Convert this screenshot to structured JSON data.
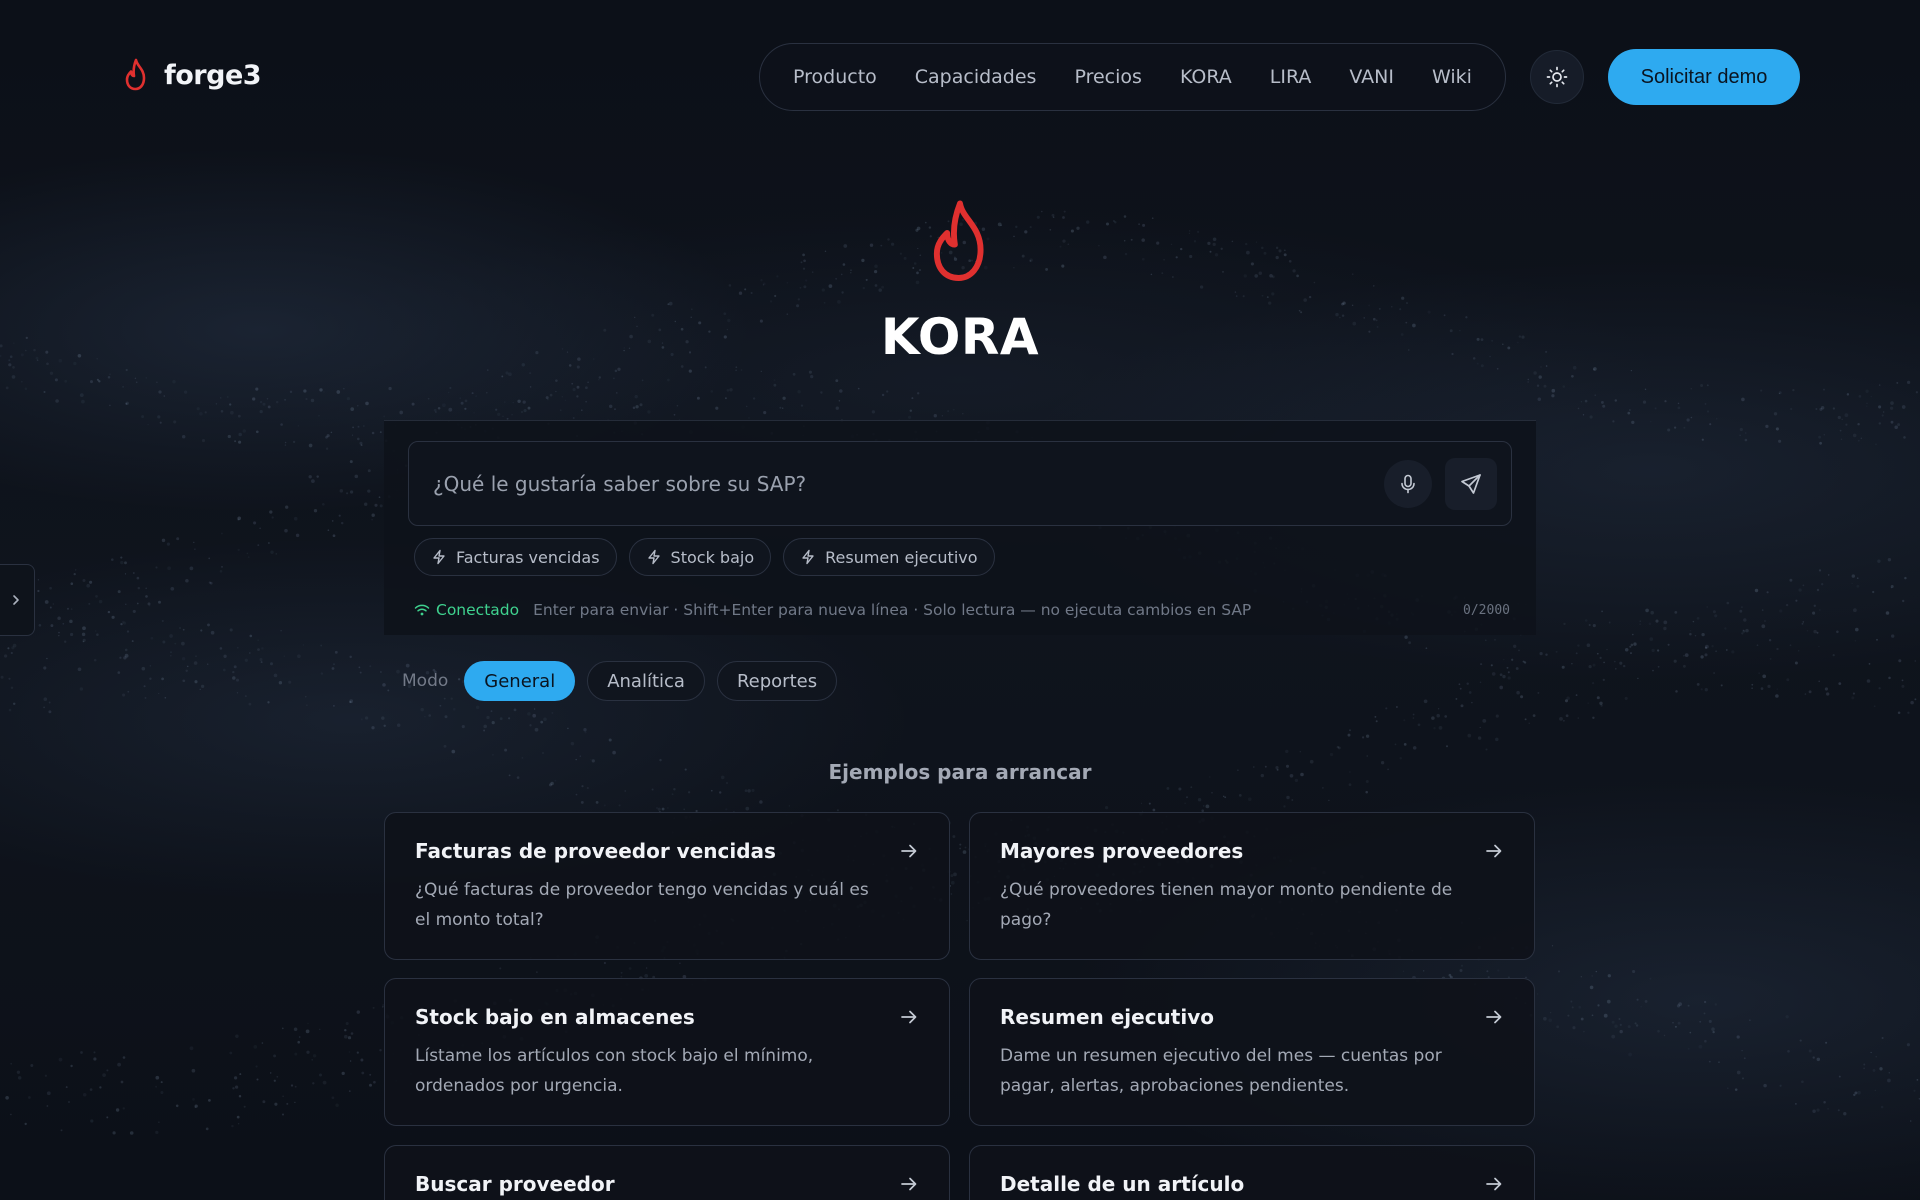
{
  "brand": {
    "name": "forge3",
    "accent": "#e0302f"
  },
  "nav": {
    "items": [
      {
        "label": "Producto"
      },
      {
        "label": "Capacidades"
      },
      {
        "label": "Precios"
      },
      {
        "label": "KORA"
      },
      {
        "label": "LIRA"
      },
      {
        "label": "VANI"
      },
      {
        "label": "Wiki"
      }
    ],
    "theme_icon": "sun-icon",
    "demo_label": "Solicitar demo",
    "demo_color": "#2eaaf0"
  },
  "hero": {
    "title": "KORA",
    "logo_icon": "flame-icon"
  },
  "chat": {
    "placeholder": "¿Qué le gustaría saber sobre su SAP?",
    "value": "",
    "mic_icon": "microphone-icon",
    "send_icon": "send-icon",
    "chips": [
      {
        "label": "Facturas vencidas",
        "icon": "lightning-icon"
      },
      {
        "label": "Stock bajo",
        "icon": "lightning-icon"
      },
      {
        "label": "Resumen ejecutivo",
        "icon": "lightning-icon"
      }
    ],
    "status": {
      "connection": "Conectado",
      "connection_color": "#3fd28f",
      "hint": "Enter para enviar · Shift+Enter para nueva línea · Solo lectura — no ejecuta cambios en SAP",
      "counter": "0/2000"
    }
  },
  "modes": {
    "label": "Modo",
    "tabs": [
      {
        "label": "General",
        "active": true
      },
      {
        "label": "Analítica",
        "active": false
      },
      {
        "label": "Reportes",
        "active": false
      }
    ]
  },
  "examples": {
    "title": "Ejemplos para arrancar",
    "cards": [
      {
        "title": "Facturas de proveedor vencidas",
        "desc": "¿Qué facturas de proveedor tengo vencidas y cuál es el monto total?"
      },
      {
        "title": "Mayores proveedores",
        "desc": "¿Qué proveedores tienen mayor monto pendiente de pago?"
      },
      {
        "title": "Stock bajo en almacenes",
        "desc": "Lístame los artículos con stock bajo el mínimo, ordenados por urgencia."
      },
      {
        "title": "Resumen ejecutivo",
        "desc": "Dame un resumen ejecutivo del mes — cuentas por pagar, alertas, aprobaciones pendientes."
      },
      {
        "title": "Buscar proveedor",
        "desc": ""
      },
      {
        "title": "Detalle de un artículo",
        "desc": ""
      }
    ]
  }
}
